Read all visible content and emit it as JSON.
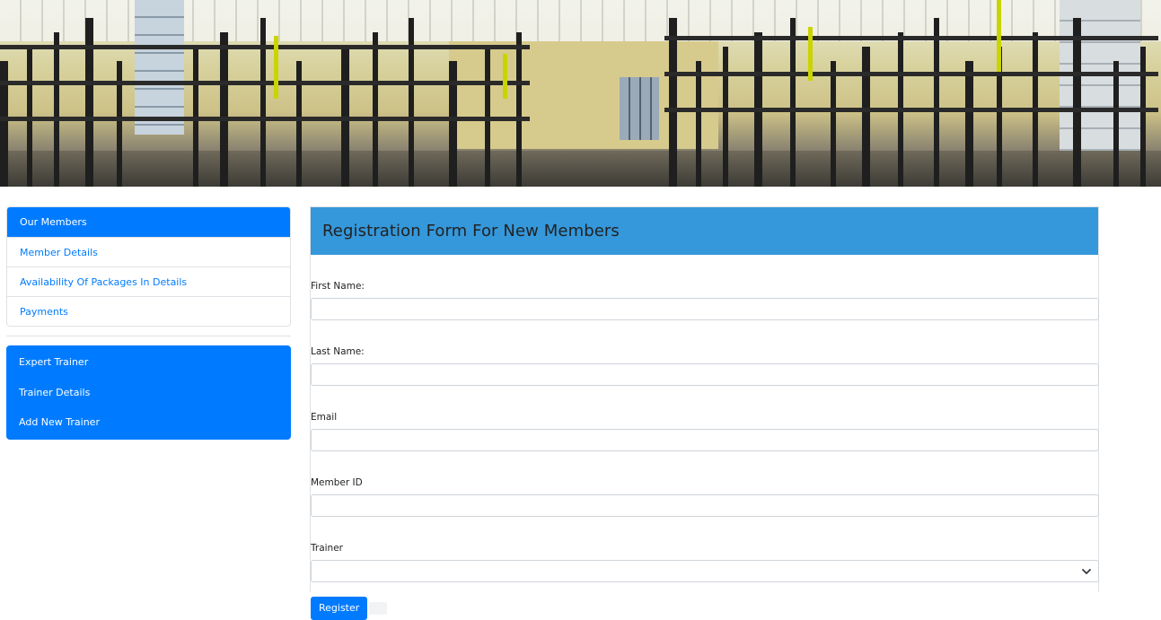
{
  "sidebar": {
    "members_group": [
      {
        "label": "Our Members",
        "active": true
      },
      {
        "label": "Member Details",
        "active": false
      },
      {
        "label": "Availability Of Packages In Details",
        "active": false
      },
      {
        "label": "Payments",
        "active": false
      }
    ],
    "trainer_group": [
      {
        "label": "Expert Trainer"
      },
      {
        "label": "Trainer Details"
      },
      {
        "label": "Add New Trainer"
      }
    ]
  },
  "form": {
    "title": "Registration Form For New Members",
    "fields": {
      "first_name": {
        "label": "First Name:",
        "value": ""
      },
      "last_name": {
        "label": "Last Name:",
        "value": ""
      },
      "email": {
        "label": "Email",
        "value": ""
      },
      "member_id": {
        "label": "Member ID",
        "value": ""
      },
      "trainer": {
        "label": "Trainer",
        "value": ""
      }
    },
    "submit_label": "Register"
  },
  "colors": {
    "primary": "#007bff",
    "header_blue": "#3498db",
    "border": "#dee2e6"
  },
  "icons": {
    "select_chevron": "chevron-down-icon"
  }
}
